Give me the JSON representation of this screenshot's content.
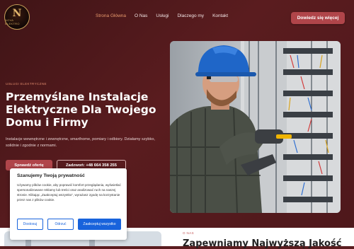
{
  "brand": {
    "logo_letter": "N",
    "logo_text": "NOVA ELEKTRO"
  },
  "nav": {
    "items": [
      "Strona Główna",
      "O Nas",
      "Usługi",
      "Dlaczego my",
      "Kontakt"
    ],
    "active_index": 0,
    "cta_label": "Dowiedz się więcej"
  },
  "hero": {
    "eyebrow": "USŁUGI ELEKTRYCZNE",
    "headline_lines": [
      "Przemyślane Instalacje",
      "Elektryczne Dla Twojego",
      "Domu i Firmy"
    ],
    "description": "Instalacje wewnętrzne i zewnętrzne, smarthome, pomiary i odbiory. Działamy szybko, solidnie i zgodnie z normami.",
    "primary_button": "Sprawdź ofertę",
    "secondary_button": "Zadzwoń: +48 664 358 255",
    "image_alt": "electrician-working-at-panel"
  },
  "about": {
    "eyebrow": "O NAS",
    "heading": "Zapewniamy Najwyższą Jakość"
  },
  "cookie_banner": {
    "title": "Szanujemy Twoją prywatność",
    "text": "Używamy plików cookie, aby poprawić komfort przeglądania, wyświetlać spersonalizowane reklamy lub treści oraz analizować ruch na naszej stronie. Klikając „Zaakceptuj wszystko”, wyrażasz zgodę na korzystanie przez nas z plików cookie.",
    "customize_label": "Dostosuj",
    "reject_label": "Odrzuć",
    "accept_label": "Zaakceptuj wszystko"
  },
  "colors": {
    "background": "#5a1c1f",
    "accent": "#b0454a",
    "nav_active": "#e89a6d",
    "cookie_button": "#1863dc"
  }
}
